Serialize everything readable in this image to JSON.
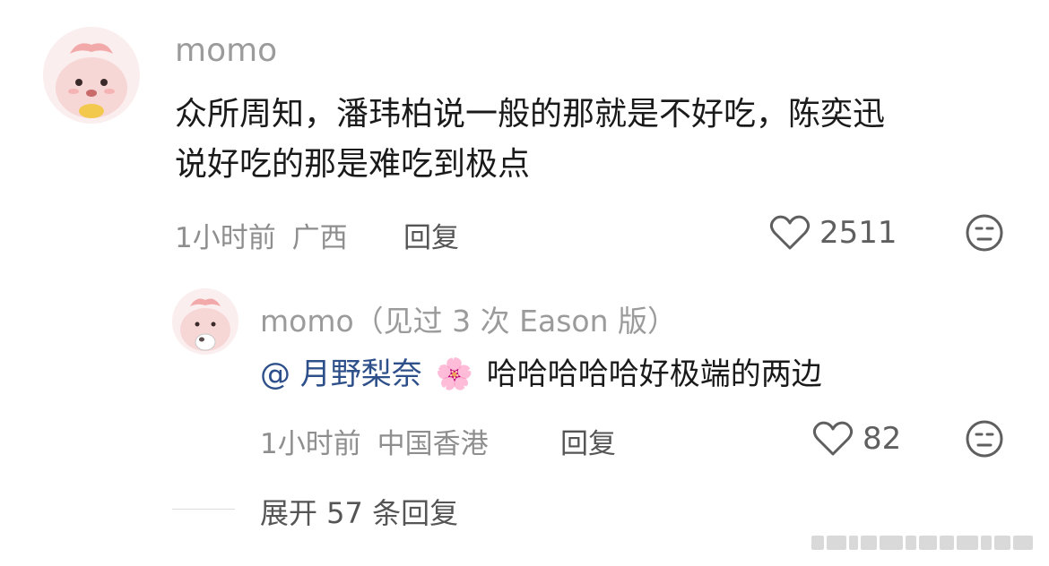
{
  "comment": {
    "username": "momo",
    "text_line1": "众所周知，潘玮柏说一般的那就是不好吃，陈奕迅",
    "text_line2": "说好吃的那是难吃到极点",
    "time": "1小时前",
    "location": "广西",
    "reply_label": "回复",
    "likes": "2511"
  },
  "reply": {
    "username": "momo",
    "username_suffix": "（见过 3 次 Eason 版）",
    "mention": "@ 月野梨奈",
    "mention_emoji": "🌸",
    "text": "哈哈哈哈哈好极端的两边",
    "time": "1小时前",
    "location": "中国香港",
    "reply_label": "回复",
    "likes": "82"
  },
  "expand_label": "展开 57 条回复",
  "colors": {
    "avatar_bg": "#fbeeee",
    "mention": "#2d4f8a",
    "meta": "#8e8e8e"
  }
}
